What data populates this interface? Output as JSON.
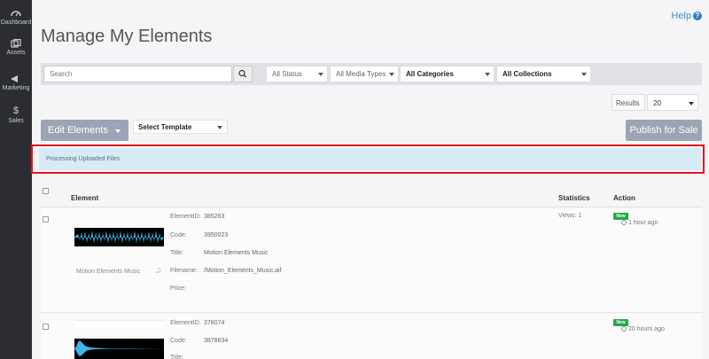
{
  "sidebar": {
    "items": [
      {
        "label": "Dashboard",
        "icon": "dashboard-icon"
      },
      {
        "label": "Assets",
        "icon": "assets-icon"
      },
      {
        "label": "Marketing",
        "icon": "megaphone-icon"
      },
      {
        "label": "Sales",
        "icon": "dollar-icon"
      }
    ]
  },
  "header": {
    "help_label": "Help",
    "title": "Manage My Elements"
  },
  "filters": {
    "search_placeholder": "Search",
    "status": "All Status",
    "media_types": "All Media Types",
    "categories": "All Categories",
    "collections": "All Collections"
  },
  "results": {
    "label": "Results",
    "value": "20"
  },
  "toolbar": {
    "edit_label": "Edit Elements",
    "template_label": "Select Template",
    "publish_label": "Publish for Sale"
  },
  "processing": {
    "message": "Processing Uploaded Files"
  },
  "table": {
    "headers": {
      "element": "Element",
      "statistics": "Statistics",
      "action": "Action"
    },
    "meta_labels": {
      "id": "ElementID:",
      "code": "Code:",
      "title": "Title:",
      "filename": "Filename:",
      "price": "Price:"
    },
    "rows": [
      {
        "element_id": "385263",
        "code": "3950023",
        "title": "Motion Elements Music",
        "filename": "/Motion_Elements_Music.aif",
        "price": "",
        "wave_title": "Motion Elements Music",
        "views": "Views: 1",
        "badge": "New",
        "time": "1 hour ago"
      },
      {
        "element_id": "378074",
        "code": "3878634",
        "title": "",
        "views": "",
        "badge": "New",
        "time": "20 hours ago"
      }
    ]
  },
  "colors": {
    "sidebar_bg": "#2b2d33",
    "accent": "#3a8fd6",
    "button_bg": "#9ca4b5",
    "info_bg": "#d7ebf5",
    "highlight_border": "#e0181e",
    "badge_green": "#2aa74a",
    "waveform": "#3fb6e8"
  }
}
